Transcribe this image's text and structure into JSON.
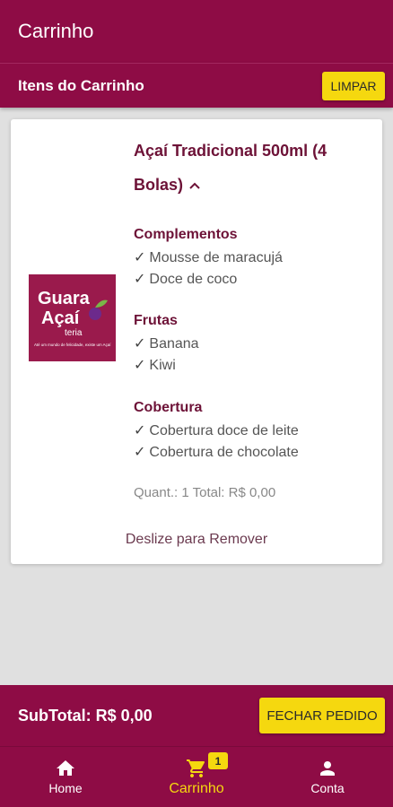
{
  "appbar": {
    "title": "Carrinho"
  },
  "cart_header": {
    "title": "Itens do Carrinho",
    "clear_label": "LIMPAR"
  },
  "item": {
    "name": "Açaí Tradicional 500ml (4 Bolas)",
    "expand_icon": "chevron-up-icon",
    "logo": {
      "line1": "Guara",
      "line2": "Açaí",
      "line3": "teria",
      "tagline": "Até um mundo de felicidade, existe um Açaí"
    },
    "groups": [
      {
        "title": "Complementos",
        "options": [
          "Mousse de maracujá",
          "Doce de coco"
        ]
      },
      {
        "title": "Frutas",
        "options": [
          "Banana",
          "Kiwi"
        ]
      },
      {
        "title": "Cobertura",
        "options": [
          "Cobertura doce de leite",
          "Cobertura de chocolate"
        ]
      }
    ],
    "quantity_total": "Quant.: 1 Total: R$ 0,00",
    "swipe_hint": "Deslize para Remover"
  },
  "checkout": {
    "subtotal": "SubTotal: R$ 0,00",
    "button_label": "FECHAR PEDIDO"
  },
  "nav": {
    "items": [
      {
        "label": "Home",
        "icon": "home-icon"
      },
      {
        "label": "Carrinho",
        "icon": "cart-icon",
        "badge": "1",
        "active": true
      },
      {
        "label": "Conta",
        "icon": "person-icon"
      }
    ]
  },
  "colors": {
    "primary": "#8e0c45",
    "accent": "#f5d80f",
    "title_text": "#6d1237"
  }
}
